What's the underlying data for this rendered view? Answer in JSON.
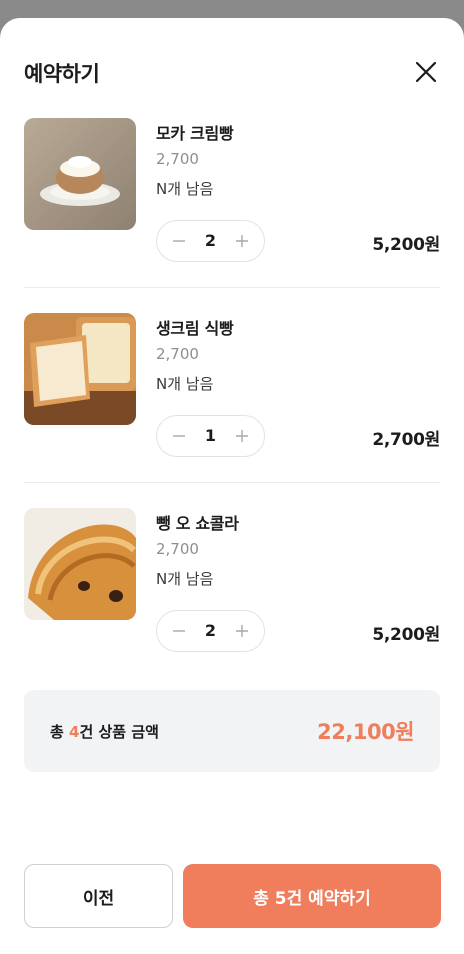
{
  "modal": {
    "title": "예약하기"
  },
  "items": [
    {
      "name": "모카 크림빵",
      "price": "2,700",
      "remaining": "N개 남음",
      "quantity": "2",
      "subtotal": "5,200원"
    },
    {
      "name": "생크림 식빵",
      "price": "2,700",
      "remaining": "N개 남음",
      "quantity": "1",
      "subtotal": "2,700원"
    },
    {
      "name": "뺑 오 쇼콜라",
      "price": "2,700",
      "remaining": "N개 남음",
      "quantity": "2",
      "subtotal": "5,200원"
    }
  ],
  "summary": {
    "prefix": "총 ",
    "count": "4",
    "suffix": "건 상품 금액",
    "amount": "22,100원"
  },
  "actions": {
    "prev_label": "이전",
    "reserve_label": "총 5건 예약하기"
  },
  "colors": {
    "accent": "#f07e5c",
    "summary_bg": "#f2f3f5"
  }
}
